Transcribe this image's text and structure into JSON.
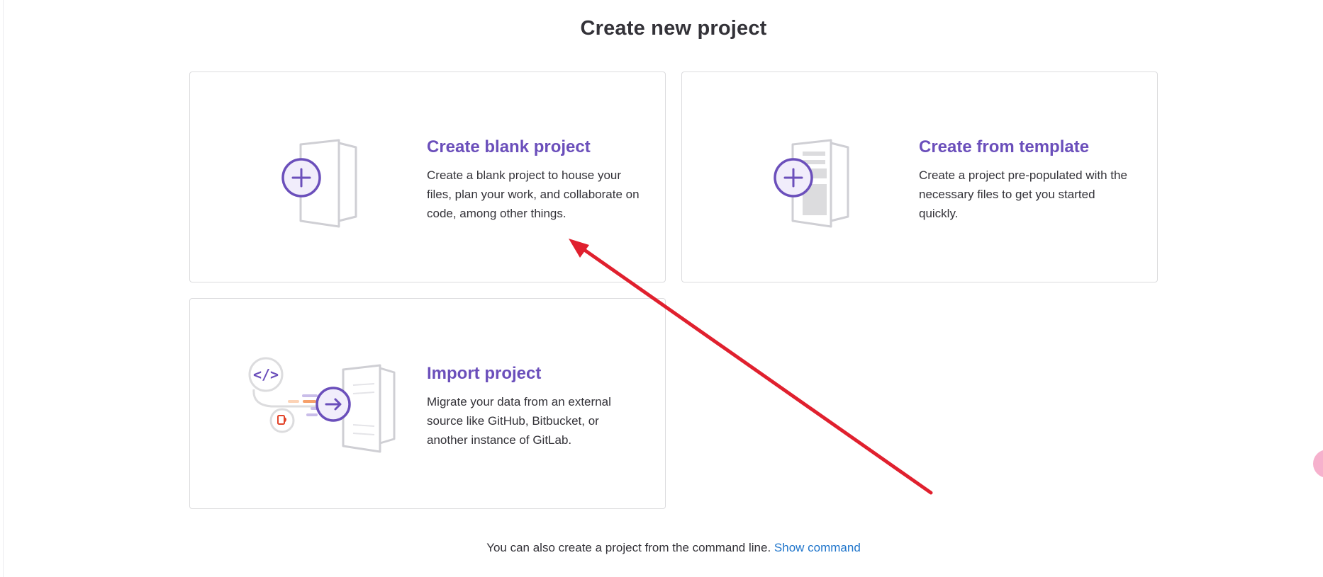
{
  "page": {
    "title": "Create new project"
  },
  "cards": [
    {
      "title": "Create blank project",
      "description": "Create a blank project to house your files, plan your work, and collaborate on code, among other things.",
      "icon": "blank-project-illustration"
    },
    {
      "title": "Create from template",
      "description": "Create a project pre-populated with the necessary files to get you started quickly.",
      "icon": "template-project-illustration"
    },
    {
      "title": "Import project",
      "description": "Migrate your data from an external source like GitHub, Bitbucket, or another instance of GitLab.",
      "icon": "import-project-illustration"
    }
  ],
  "footer": {
    "text": "You can also create a project from the command line.",
    "link_label": "Show command"
  },
  "colors": {
    "accent": "#6b4fbb",
    "link": "#1f75cb",
    "annotation_arrow": "#e0202e",
    "border": "#dcdcde"
  }
}
